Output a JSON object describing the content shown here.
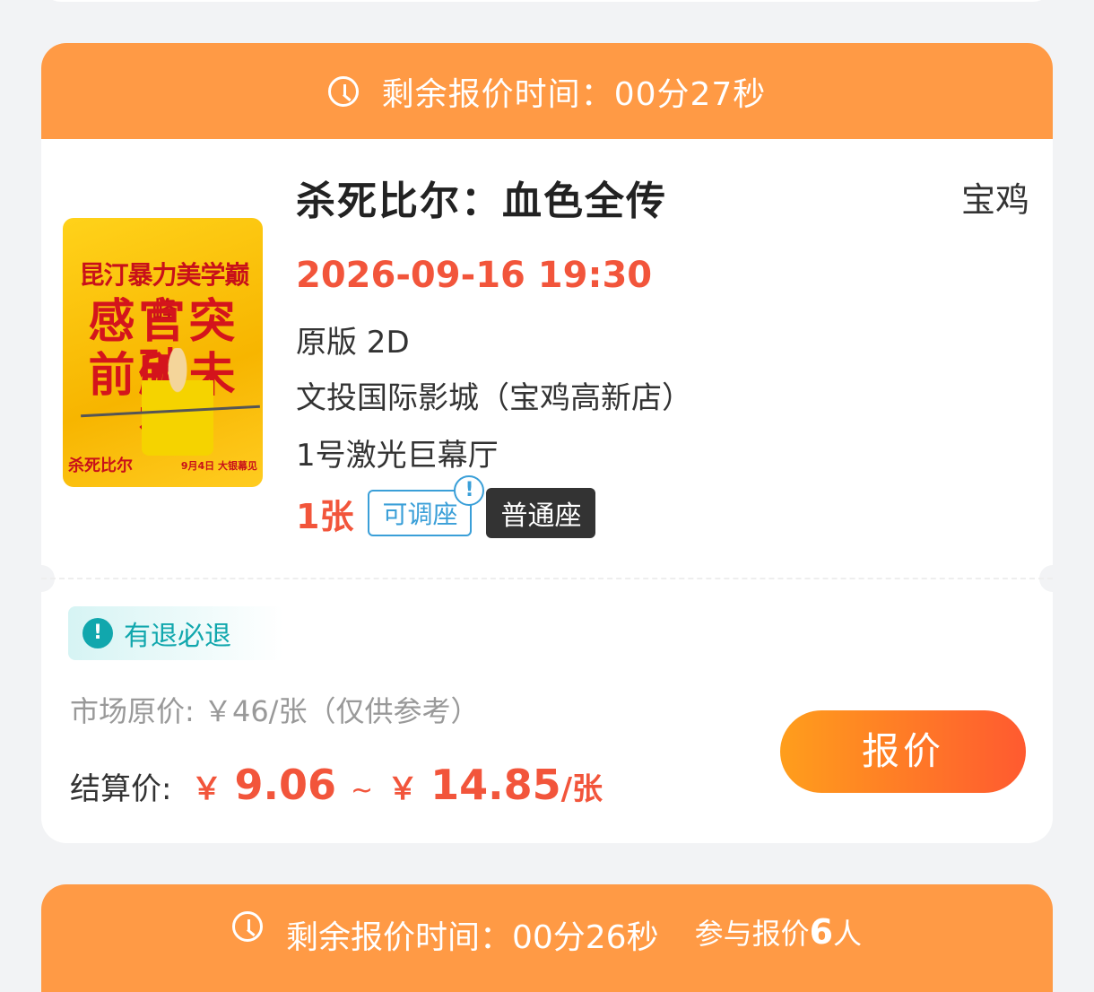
{
  "cards": [
    {
      "countdown_label": "剩余报价时间：",
      "countdown_value": "00分27秒",
      "poster": {
        "tagline": "昆汀暴力美学巅峰",
        "line1": "感官突破",
        "line2": "前所未有",
        "title": "杀死比尔",
        "date": "9月4日 大银幕见"
      },
      "movie_title": "杀死比尔：血色全传",
      "city": "宝鸡",
      "showtime": "2026-09-16 19:30",
      "version": "原版 2D",
      "cinema": "文投国际影城（宝鸡高新店）",
      "hall": "1号激光巨幕厅",
      "ticket_count": "1张",
      "tag_adjustable": "可调座",
      "tag_alert": "!",
      "tag_seat": "普通座",
      "refund_label": "有退必退",
      "refund_icon": "!",
      "market_price": "市场原价: ￥46/张（仅供参考）",
      "settle_label": "结算价:",
      "settle_currency": "￥",
      "settle_min": "9.06",
      "settle_tilde": "~",
      "settle_max": "14.85",
      "settle_unit": "/张",
      "quote_button": "报价"
    },
    {
      "countdown_label": "剩余报价时间：",
      "countdown_value": "00分26秒",
      "participants_label": "参与报价",
      "participants_count": "6",
      "participants_unit": "人"
    }
  ],
  "colors": {
    "header_orange": "#ff9a45",
    "price_red": "#f2553b",
    "refund_teal": "#11a7ad",
    "adjust_blue": "#3a9fd8"
  }
}
